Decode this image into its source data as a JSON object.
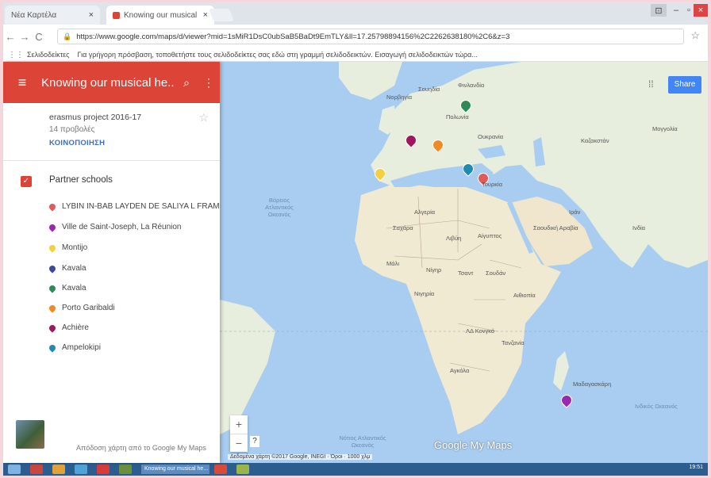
{
  "browser": {
    "tabs": [
      {
        "label": "Νέα Καρτέλα",
        "active": false
      },
      {
        "label": "Knowing our musical he...",
        "active": true
      }
    ],
    "address": "https://www.google.com/maps/d/viewer?mid=1sMiR1DsC0ubSaB5BaDt9EmTLY&ll=17.25798894156%2C2262638180%2C6&z=3",
    "bookmarks_label": "Σελιδοδείκτες",
    "bookmarks_hint": "Για γρήγορη πρόσβαση, τοποθετήστε τους σελιδοδείκτες σας εδώ στη γραμμή σελιδοδεικτών. Εισαγωγή σελιδοδεικτών τώρα..."
  },
  "sidebar": {
    "title": "Knowing our musical he...",
    "project": "erasmus project 2016-17",
    "views": "14 προβολές",
    "share_link": "ΚΟΙΝΟΠΟΙΗΣΗ",
    "layer_title": "Partner schools",
    "places": [
      {
        "name": "LYBIN IN-BAB LAYDEN DE SALIYA L FRAM",
        "color": "#e05a5a"
      },
      {
        "name": "Ville de Saint-Joseph, La Réunion",
        "color": "#9c27b0"
      },
      {
        "name": "Montijo",
        "color": "#f4d03f"
      },
      {
        "name": "Kavala",
        "color": "#3c4a9e"
      },
      {
        "name": "Kavala",
        "color": "#2e8b57"
      },
      {
        "name": "Porto Garibaldi",
        "color": "#f08a24"
      },
      {
        "name": "Achière",
        "color": "#a1175f"
      },
      {
        "name": "Ampelokipi",
        "color": "#1f8bb5"
      }
    ],
    "credit": "Απόδοση χάρτη από το Google My Maps"
  },
  "map": {
    "share_button": "Share",
    "logo": "Google My Maps",
    "attribution": "Δεδομένα χάρτη ©2017 Google, INEGI · Όροι · 1000 χλμ",
    "labels": [
      {
        "text": "Βόρειος Ατλαντικός Ωκεανός",
        "kind": "ocean"
      },
      {
        "text": "Νότιος Ατλαντικός Ωκεανός",
        "kind": "ocean"
      },
      {
        "text": "Ινδικός Ωκεανός",
        "kind": "ocean"
      },
      {
        "text": "Σαχάρα",
        "kind": "land"
      },
      {
        "text": "Λιβύη",
        "kind": "land"
      },
      {
        "text": "Αίγυπτος",
        "kind": "land"
      },
      {
        "text": "Αλγερία",
        "kind": "land"
      },
      {
        "text": "Μάλι",
        "kind": "land"
      },
      {
        "text": "Νίγηρ",
        "kind": "land"
      },
      {
        "text": "Τσαντ",
        "kind": "land"
      },
      {
        "text": "Σουδάν",
        "kind": "land"
      },
      {
        "text": "Αιθιοπία",
        "kind": "land"
      },
      {
        "text": "Νιγηρία",
        "kind": "land"
      },
      {
        "text": "ΛΔ Κονγκό",
        "kind": "land"
      },
      {
        "text": "Τανζανία",
        "kind": "land"
      },
      {
        "text": "Αγκόλα",
        "kind": "land"
      },
      {
        "text": "Μαδαγασκάρη",
        "kind": "land"
      },
      {
        "text": "Ιράν",
        "kind": "land"
      },
      {
        "text": "Σαουδική Αραβία",
        "kind": "land"
      },
      {
        "text": "Καζακστάν",
        "kind": "land"
      },
      {
        "text": "Μογγολία",
        "kind": "land"
      },
      {
        "text": "Ινδία",
        "kind": "land"
      },
      {
        "text": "Ουκρανία",
        "kind": "land"
      },
      {
        "text": "Πολωνία",
        "kind": "land"
      },
      {
        "text": "Τουρκία",
        "kind": "land"
      },
      {
        "text": "Σουηδία",
        "kind": "land"
      },
      {
        "text": "Φινλανδία",
        "kind": "land"
      },
      {
        "text": "Νορβηγία",
        "kind": "land"
      }
    ]
  },
  "taskbar": {
    "window": "Knowing our musical he...",
    "time": "19:51"
  },
  "colors": {
    "header_red": "#db4437",
    "share_blue": "#4285f4",
    "sea": "#a8cdf0",
    "land": "#e8eedd",
    "desert": "#f1ead3"
  }
}
